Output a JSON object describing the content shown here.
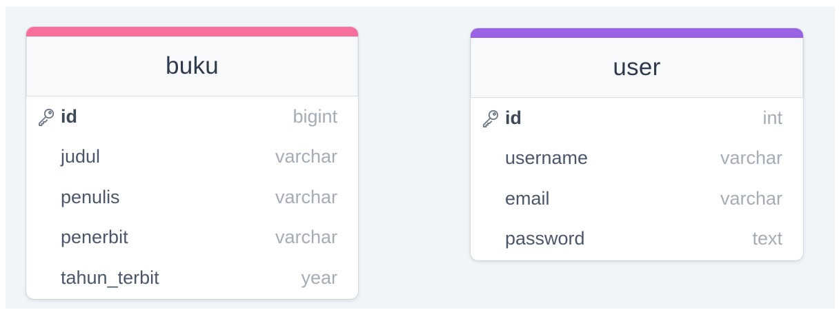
{
  "tables": [
    {
      "name": "buku",
      "accent_color": "#f7709b",
      "columns": [
        {
          "name": "id",
          "type": "bigint",
          "primary_key": true,
          "icon": "key-icon"
        },
        {
          "name": "judul",
          "type": "varchar",
          "primary_key": false
        },
        {
          "name": "penulis",
          "type": "varchar",
          "primary_key": false
        },
        {
          "name": "penerbit",
          "type": "varchar",
          "primary_key": false
        },
        {
          "name": "tahun_terbit",
          "type": "year",
          "primary_key": false
        }
      ]
    },
    {
      "name": "user",
      "accent_color": "#9a63e4",
      "columns": [
        {
          "name": "id",
          "type": "int",
          "primary_key": true,
          "icon": "key-icon"
        },
        {
          "name": "username",
          "type": "varchar",
          "primary_key": false
        },
        {
          "name": "email",
          "type": "varchar",
          "primary_key": false
        },
        {
          "name": "password",
          "type": "text",
          "primary_key": false
        }
      ]
    }
  ]
}
